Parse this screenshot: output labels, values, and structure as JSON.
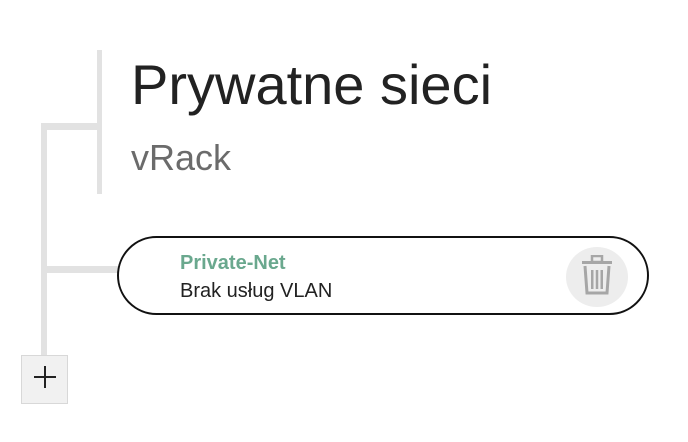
{
  "header": {
    "title": "Prywatne sieci",
    "subtitle": "vRack"
  },
  "networks": [
    {
      "name": "Private-Net",
      "status": "Brak usług VLAN",
      "delete_icon": "trash-icon"
    }
  ],
  "actions": {
    "add_icon": "plus-icon"
  },
  "colors": {
    "network_name": "#6aa88e",
    "tree_line": "#e2e2e2",
    "card_border": "#111111",
    "icon_gray": "#a6a6a6",
    "icon_bg": "#ededed"
  }
}
